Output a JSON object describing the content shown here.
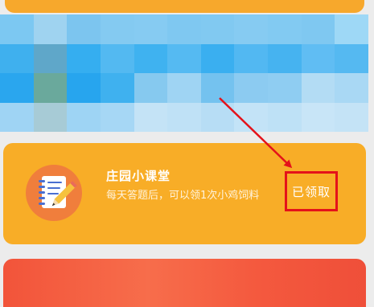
{
  "task": {
    "title": "庄园小课堂",
    "description": "每天答题后，可以领1次小鸡饲料",
    "button_label": "已领取",
    "icon": "notebook-pencil-icon"
  },
  "colors": {
    "card_orange": "#f8ad27",
    "icon_circle": "#f07e3c",
    "highlight_red": "#e4121a",
    "bottom_card_red": "#f2543a",
    "banner_blue": "#2aa6ee"
  }
}
